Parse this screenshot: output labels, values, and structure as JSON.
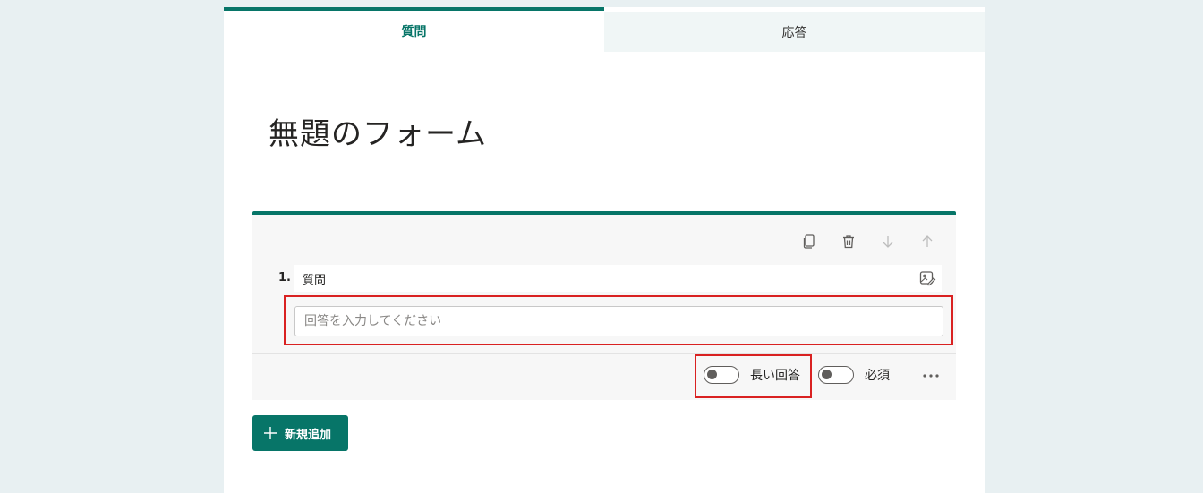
{
  "tabs": [
    {
      "label": "質問",
      "active": true
    },
    {
      "label": "応答",
      "active": false
    }
  ],
  "form": {
    "title": "無題のフォーム"
  },
  "question": {
    "number": "1.",
    "title": "質問",
    "answer_placeholder": "回答を入力してください",
    "answer_value": ""
  },
  "options": {
    "long_answer_label": "長い回答",
    "long_answer_on": false,
    "required_label": "必須",
    "required_on": false
  },
  "toolbar": {
    "icons": [
      "copy-icon",
      "delete-icon",
      "move-down-icon",
      "move-up-icon"
    ]
  },
  "add_button": {
    "label": "新規追加"
  },
  "colors": {
    "accent": "#077568",
    "highlight": "#d92121",
    "background": "#e8f0f2"
  }
}
